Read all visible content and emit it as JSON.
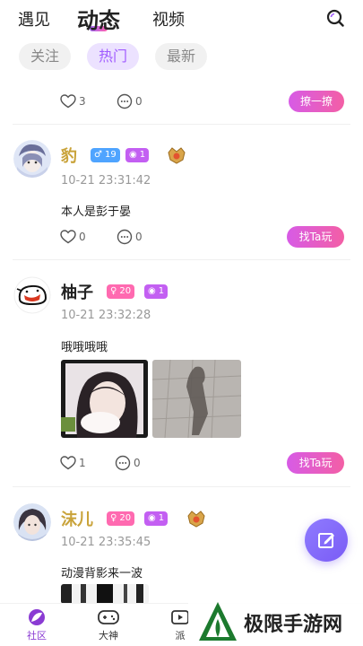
{
  "header": {
    "tabs": [
      {
        "label": "遇见"
      },
      {
        "label": "动态"
      },
      {
        "label": "视频"
      }
    ]
  },
  "filters": {
    "chips": [
      {
        "label": "关注"
      },
      {
        "label": "热门"
      },
      {
        "label": "最新"
      }
    ]
  },
  "prev_post": {
    "likes": "3",
    "comments": "0",
    "action": "撩一撩"
  },
  "posts": [
    {
      "username": "豹",
      "gender_badge": "19",
      "level_badge": "1",
      "time": "10-21 23:31:42",
      "text": "本人是彭于晏",
      "likes": "0",
      "comments": "0",
      "action": "找Ta玩"
    },
    {
      "username": "柚子",
      "gender_badge": "20",
      "level_badge": "1",
      "time": "10-21 23:32:28",
      "text": "哦哦哦哦",
      "likes": "1",
      "comments": "0",
      "action": "找Ta玩"
    },
    {
      "username": "沫儿",
      "gender_badge": "20",
      "level_badge": "1",
      "time": "10-21 23:35:45",
      "text": "动漫背影来一波"
    }
  ],
  "bottom_nav": [
    {
      "label": "社区"
    },
    {
      "label": "大神"
    },
    {
      "label": "派"
    }
  ],
  "watermark": {
    "text": "极限手游网"
  },
  "colors": {
    "accent": "#a15cff",
    "button_gradient_start": "#d75be6",
    "button_gradient_end": "#f35fa5",
    "username_gold": "#c9a33a"
  }
}
